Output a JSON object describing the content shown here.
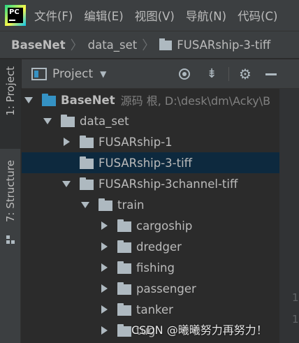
{
  "menubar": {
    "logo_text": "PC",
    "items": [
      "文件(F)",
      "编辑(E)",
      "视图(V)",
      "导航(N)",
      "代码(C)"
    ]
  },
  "breadcrumb": {
    "items": [
      "BaseNet",
      "data_set",
      "FUSARship-3-tiff"
    ]
  },
  "left_strip": {
    "project_tab": "1: Project",
    "structure_tab": "7: Structure"
  },
  "project_panel": {
    "title": "Project",
    "icons": [
      "target-icon",
      "collapse-all-icon",
      "gear-icon",
      "minimize-icon"
    ]
  },
  "tree": {
    "root": {
      "label": "BaseNet",
      "hint": "源码 根, D:\\desk\\dm\\Acky\\B"
    },
    "nodes": [
      {
        "label": "data_set",
        "expanded": true
      },
      {
        "label": "FUSARship-1",
        "expanded": false
      },
      {
        "label": "FUSARship-3-tiff",
        "selected": true
      },
      {
        "label": "FUSARship-3channel-tiff",
        "expanded": true
      },
      {
        "label": "train",
        "expanded": true
      },
      {
        "label": "cargoship",
        "expanded": false
      },
      {
        "label": "dredger",
        "expanded": false
      },
      {
        "label": "fishing",
        "expanded": false
      },
      {
        "label": "passenger",
        "expanded": false
      },
      {
        "label": "tanker",
        "expanded": false
      },
      {
        "label": "tug",
        "expanded": false
      }
    ]
  },
  "gutter_numbers": [
    "1",
    "1"
  ],
  "watermark": "CSDN @曦曦努力再努力！",
  "colors": {
    "background": "#2b2b2b",
    "chrome": "#3c3f41",
    "selection": "#0d293e",
    "text": "#bbbbbb",
    "module_folder": "#3592c4"
  }
}
